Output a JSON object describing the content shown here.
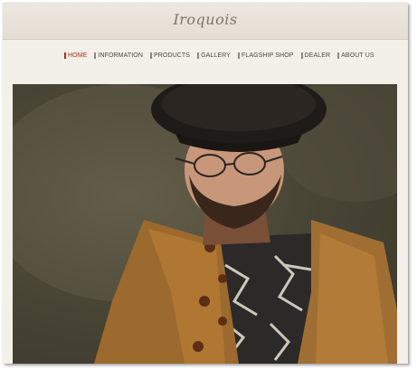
{
  "header": {
    "logo": "Iroquois"
  },
  "nav": {
    "items": [
      {
        "label": "HOME",
        "active": true
      },
      {
        "label": "INFORMATION"
      },
      {
        "label": "PRODUCTS"
      },
      {
        "label": "GALLERY"
      },
      {
        "label": "FLAGSHIP SHOP"
      },
      {
        "label": "DEALER"
      },
      {
        "label": "ABOUT US"
      }
    ]
  },
  "hero": {
    "image": "man-in-beret-and-leather-jacket-photo"
  },
  "colors": {
    "accent": "#b02a1a",
    "nav_text": "#4a4540",
    "header_bg": "#e8e2d9",
    "page_bg": "#f3f0ea"
  }
}
